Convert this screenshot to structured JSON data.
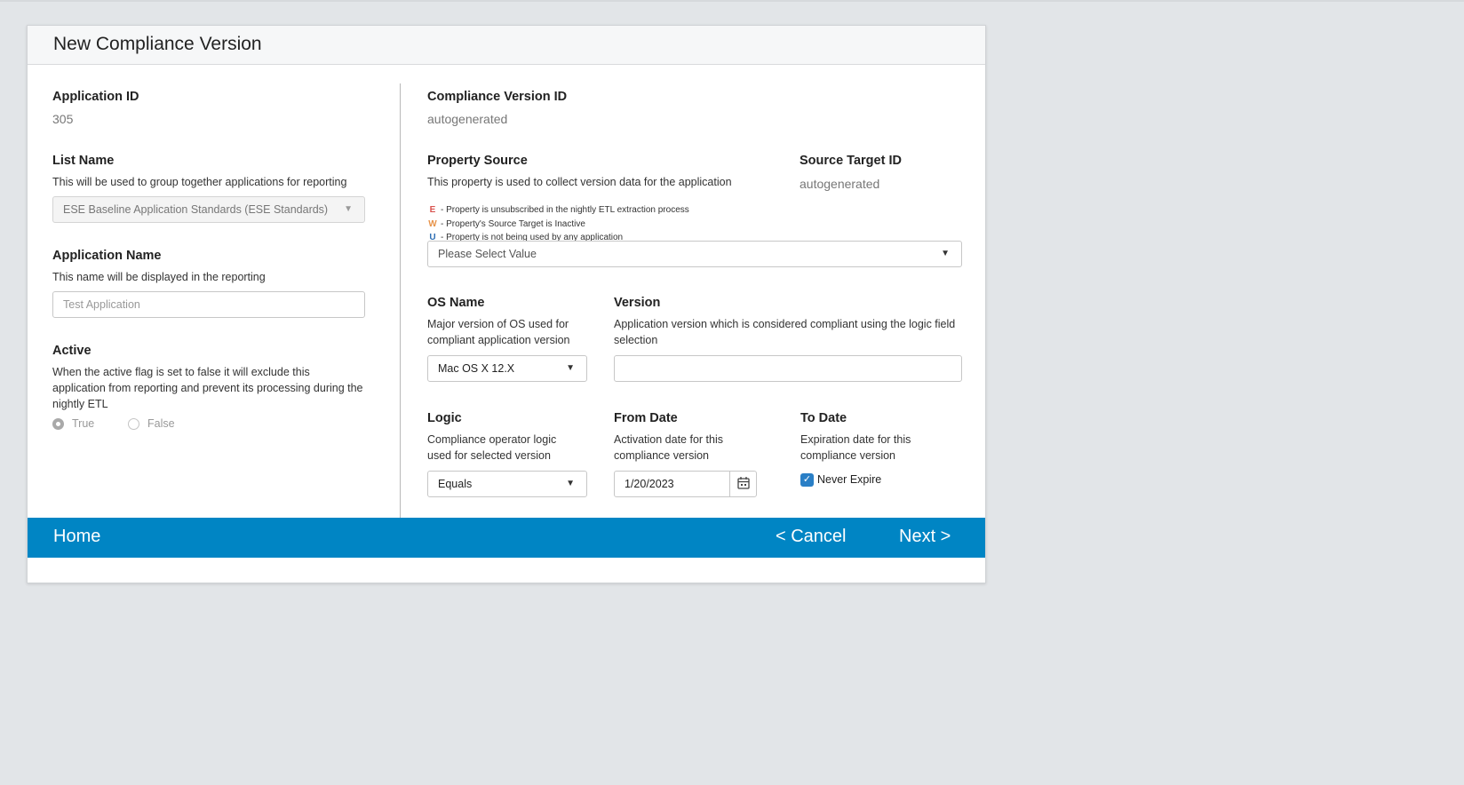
{
  "title": "New Compliance Version",
  "app_id": {
    "label": "Application ID",
    "value": "305"
  },
  "list_name": {
    "label": "List Name",
    "help": "This will be used to group together applications for reporting",
    "value": "ESE Baseline Application Standards (ESE Standards)"
  },
  "app_name": {
    "label": "Application Name",
    "help": "This name will be displayed in the reporting",
    "placeholder": "Test Application"
  },
  "active": {
    "label": "Active",
    "help": "When the active flag is set to false it will exclude this application from reporting and prevent its processing during the nightly ETL",
    "options": [
      "True",
      "False"
    ],
    "selected": "True"
  },
  "compliance_version_id": {
    "label": "Compliance Version ID",
    "value": "autogenerated"
  },
  "property_source": {
    "label": "Property Source",
    "help": "This property is used to collect version data for the application",
    "legend": [
      {
        "code": "E",
        "text": "- Property is unsubscribed in the nightly ETL extraction process",
        "color": "#d9534f"
      },
      {
        "code": "W",
        "text": "- Property's Source Target is Inactive",
        "color": "#e8944a"
      },
      {
        "code": "U",
        "text": "- Property is not being used by any application",
        "color": "#2f6fb4"
      }
    ],
    "placeholder": "Please Select Value"
  },
  "source_target_id": {
    "label": "Source Target ID",
    "value": "autogenerated"
  },
  "os_name": {
    "label": "OS Name",
    "help": "Major version of OS used for compliant application version",
    "value": "Mac OS X 12.X"
  },
  "version": {
    "label": "Version",
    "help": "Application version which is considered compliant using the logic field selection",
    "value": ""
  },
  "logic": {
    "label": "Logic",
    "help": "Compliance operator logic used for selected version",
    "value": "Equals"
  },
  "from_date": {
    "label": "From Date",
    "help": "Activation date for this compliance version",
    "value": "1/20/2023"
  },
  "to_date": {
    "label": "To Date",
    "help": "Expiration date for this compliance version",
    "never_expire_label": "Never Expire",
    "never_expire": true
  },
  "footer": {
    "home": "Home",
    "cancel": "< Cancel",
    "next": "Next >"
  },
  "colors": {
    "footer_bg": "#0085c4",
    "checkbox": "#2a7fc6"
  }
}
